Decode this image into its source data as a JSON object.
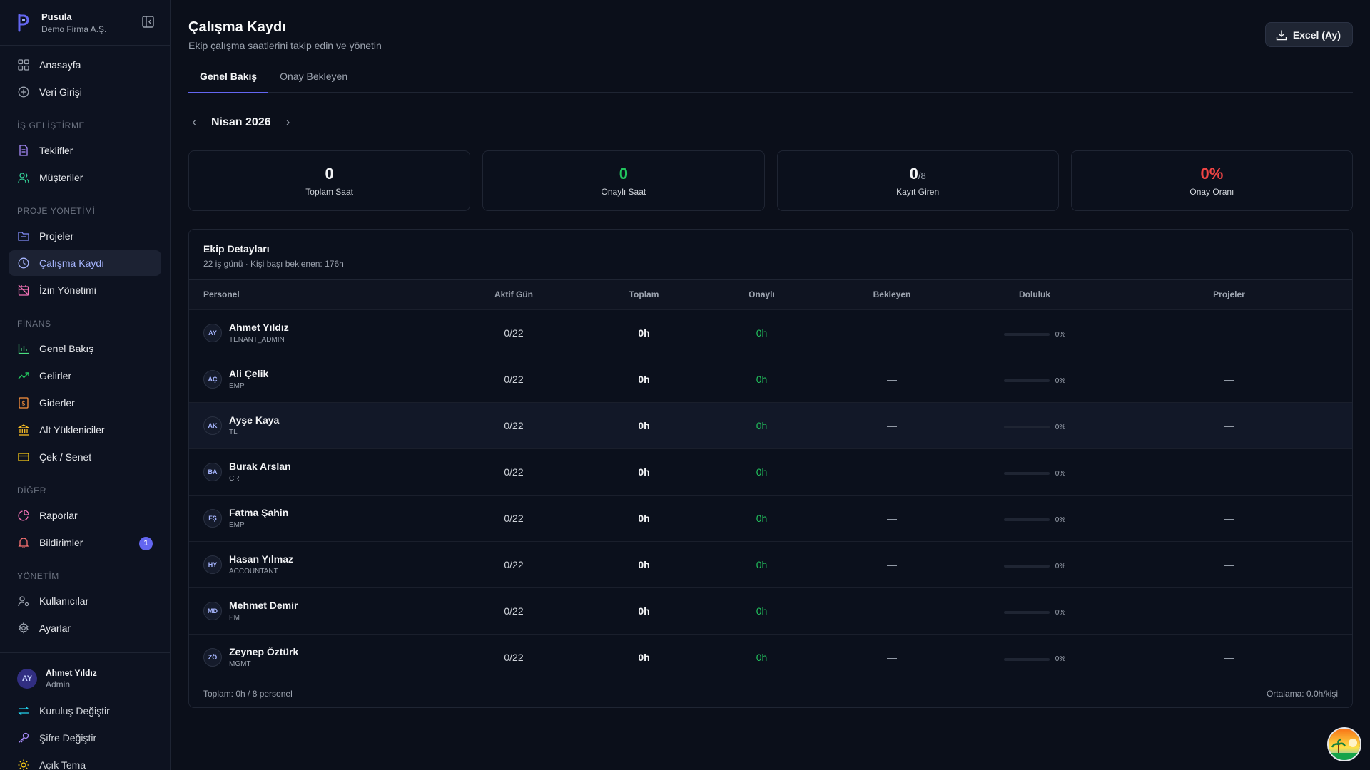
{
  "brand": {
    "name": "Pusula",
    "company": "Demo Firma A.Ş."
  },
  "sidebar": {
    "top_items": [
      {
        "label": "Anasayfa"
      },
      {
        "label": "Veri Girişi"
      }
    ],
    "sections": [
      {
        "title": "İŞ GELİŞTİRME",
        "items": [
          {
            "label": "Teklifler"
          },
          {
            "label": "Müşteriler"
          }
        ]
      },
      {
        "title": "PROJE YÖNETİMİ",
        "items": [
          {
            "label": "Projeler"
          },
          {
            "label": "Çalışma Kaydı"
          },
          {
            "label": "İzin Yönetimi"
          }
        ]
      },
      {
        "title": "FİNANS",
        "items": [
          {
            "label": "Genel Bakış"
          },
          {
            "label": "Gelirler"
          },
          {
            "label": "Giderler"
          },
          {
            "label": "Alt Yükleniciler"
          },
          {
            "label": "Çek / Senet"
          }
        ]
      },
      {
        "title": "DİĞER",
        "items": [
          {
            "label": "Raporlar"
          },
          {
            "label": "Bildirimler",
            "badge": "1"
          }
        ]
      },
      {
        "title": "YÖNETİM",
        "items": [
          {
            "label": "Kullanıcılar"
          },
          {
            "label": "Ayarlar"
          }
        ]
      }
    ],
    "user": {
      "initials": "AY",
      "name": "Ahmet Yıldız",
      "role": "Admin"
    },
    "bottom_items": [
      {
        "label": "Kuruluş Değiştir"
      },
      {
        "label": "Şifre Değiştir"
      },
      {
        "label": "Açık Tema"
      }
    ]
  },
  "header": {
    "title": "Çalışma Kaydı",
    "subtitle": "Ekip çalışma saatlerini takip edin ve yönetin",
    "excel_button": "Excel (Ay)"
  },
  "tabs": [
    {
      "label": "Genel Bakış"
    },
    {
      "label": "Onay Bekleyen"
    }
  ],
  "month_nav": {
    "prev": "‹",
    "label": "Nisan 2026",
    "next": "›"
  },
  "stats": [
    {
      "value": "0",
      "suffix": "",
      "label": "Toplam Saat"
    },
    {
      "value": "0",
      "suffix": "",
      "label": "Onaylı Saat"
    },
    {
      "value": "0",
      "suffix": "/8",
      "label": "Kayıt Giren"
    },
    {
      "value": "0%",
      "suffix": "",
      "label": "Onay Oranı"
    }
  ],
  "colors": {
    "accent": "#6366f1",
    "green": "#22c55e",
    "red": "#ef4444",
    "background": "#0b0f1a"
  },
  "team": {
    "title": "Ekip Detayları",
    "subtitle": "22 iş günü · Kişi başı beklenen: 176h",
    "columns": [
      "Personel",
      "Aktif Gün",
      "Toplam",
      "Onaylı",
      "Bekleyen",
      "Doluluk",
      "Projeler"
    ],
    "rows": [
      {
        "initials": "AY",
        "name": "Ahmet Yıldız",
        "role": "TENANT_ADMIN",
        "active_days": "0/22",
        "total": "0h",
        "approved": "0h",
        "pending": "—",
        "fill_pct": 0,
        "fill_label": "0%",
        "projects": "—"
      },
      {
        "initials": "AÇ",
        "name": "Ali Çelik",
        "role": "EMP",
        "active_days": "0/22",
        "total": "0h",
        "approved": "0h",
        "pending": "—",
        "fill_pct": 0,
        "fill_label": "0%",
        "projects": "—"
      },
      {
        "initials": "AK",
        "name": "Ayşe Kaya",
        "role": "TL",
        "active_days": "0/22",
        "total": "0h",
        "approved": "0h",
        "pending": "—",
        "fill_pct": 0,
        "fill_label": "0%",
        "projects": "—"
      },
      {
        "initials": "BA",
        "name": "Burak Arslan",
        "role": "CR",
        "active_days": "0/22",
        "total": "0h",
        "approved": "0h",
        "pending": "—",
        "fill_pct": 0,
        "fill_label": "0%",
        "projects": "—"
      },
      {
        "initials": "FŞ",
        "name": "Fatma Şahin",
        "role": "EMP",
        "active_days": "0/22",
        "total": "0h",
        "approved": "0h",
        "pending": "—",
        "fill_pct": 0,
        "fill_label": "0%",
        "projects": "—"
      },
      {
        "initials": "HY",
        "name": "Hasan Yılmaz",
        "role": "ACCOUNTANT",
        "active_days": "0/22",
        "total": "0h",
        "approved": "0h",
        "pending": "—",
        "fill_pct": 0,
        "fill_label": "0%",
        "projects": "—"
      },
      {
        "initials": "MD",
        "name": "Mehmet Demir",
        "role": "PM",
        "active_days": "0/22",
        "total": "0h",
        "approved": "0h",
        "pending": "—",
        "fill_pct": 0,
        "fill_label": "0%",
        "projects": "—"
      },
      {
        "initials": "ZÖ",
        "name": "Zeynep Öztürk",
        "role": "MGMT",
        "active_days": "0/22",
        "total": "0h",
        "approved": "0h",
        "pending": "—",
        "fill_pct": 0,
        "fill_label": "0%",
        "projects": "—"
      }
    ],
    "footer_left": "Toplam: 0h / 8 personel",
    "footer_right": "Ortalama: 0.0h/kişi"
  }
}
